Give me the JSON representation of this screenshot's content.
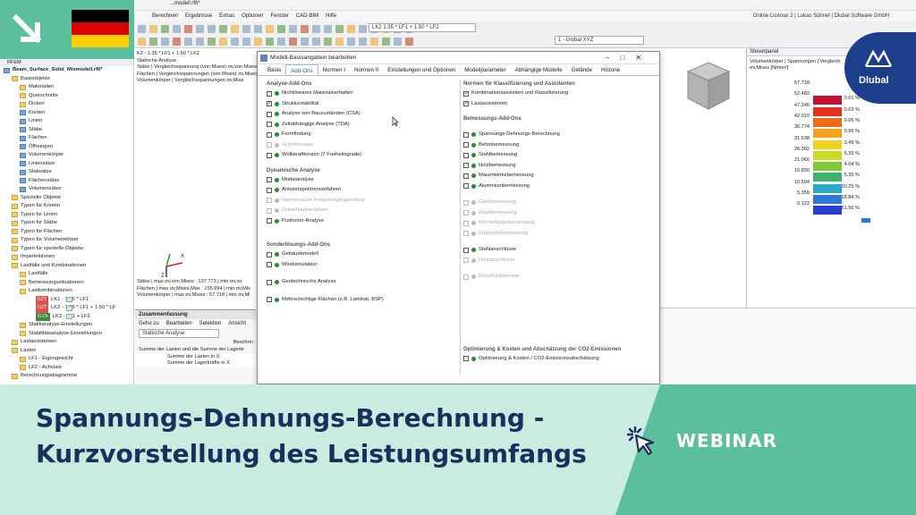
{
  "window": {
    "title_fragment": "...modell.rf6*",
    "license": "Online License 2 | Lukas Sühnel | Dlubal Software GmbH"
  },
  "menubar": [
    "Berechnen",
    "Ergebnisse",
    "Extras",
    "Optionen",
    "Fenster",
    "CAD-BIM",
    "Hilfe"
  ],
  "toolbar": {
    "load_combo": "LK2   1.35 * LF1 + 1.50 * LF2",
    "view_combo": "1 - Global XYZ"
  },
  "tree": {
    "header": "RFEM",
    "items": [
      {
        "label": "Beam_Surface_Solid_Mixmodell.rf6*",
        "indent": 0,
        "icon": "b",
        "bold": true
      },
      {
        "label": "Basisobjekte",
        "indent": 1,
        "icon": "f"
      },
      {
        "label": "Materialien",
        "indent": 2,
        "icon": "f"
      },
      {
        "label": "Querschnitte",
        "indent": 2,
        "icon": "f"
      },
      {
        "label": "Dicken",
        "indent": 2,
        "icon": "f"
      },
      {
        "label": "Knoten",
        "indent": 2,
        "icon": "b"
      },
      {
        "label": "Linien",
        "indent": 2,
        "icon": "b"
      },
      {
        "label": "Stäbe",
        "indent": 2,
        "icon": "b"
      },
      {
        "label": "Flächen",
        "indent": 2,
        "icon": "b"
      },
      {
        "label": "Öffnungen",
        "indent": 2,
        "icon": "b"
      },
      {
        "label": "Volumenkörper",
        "indent": 2,
        "icon": "b"
      },
      {
        "label": "Liniensätze",
        "indent": 2,
        "icon": "b"
      },
      {
        "label": "Stabsätze",
        "indent": 2,
        "icon": "b"
      },
      {
        "label": "Flächensätze",
        "indent": 2,
        "icon": "b"
      },
      {
        "label": "Volumensätze",
        "indent": 2,
        "icon": "b"
      },
      {
        "label": "Spezielle Objekte",
        "indent": 1,
        "icon": "f"
      },
      {
        "label": "Typen für Knoten",
        "indent": 1,
        "icon": "f"
      },
      {
        "label": "Typen für Linien",
        "indent": 1,
        "icon": "f"
      },
      {
        "label": "Typen für Stäbe",
        "indent": 1,
        "icon": "f"
      },
      {
        "label": "Typen für Flächen",
        "indent": 1,
        "icon": "f"
      },
      {
        "label": "Typen für Volumenkörper",
        "indent": 1,
        "icon": "f"
      },
      {
        "label": "Typen für spezielle Objekte",
        "indent": 1,
        "icon": "f"
      },
      {
        "label": "Imperfektionen",
        "indent": 1,
        "icon": "f"
      },
      {
        "label": "Lastfälle und Kombinationen",
        "indent": 1,
        "icon": "f"
      },
      {
        "label": "Lastfälle",
        "indent": 2,
        "icon": "f"
      },
      {
        "label": "Bemessungssituationen",
        "indent": 2,
        "icon": "f"
      },
      {
        "label": "Lastkombinationen",
        "indent": 2,
        "icon": "f"
      },
      {
        "label": "LK1 - 1.35 * LF1",
        "indent": 4,
        "icon": "lc",
        "tag": "GZT"
      },
      {
        "label": "LK2 - 1.35 * LF1 + 1.50 * LF",
        "indent": 4,
        "icon": "lc",
        "tag": "GZT"
      },
      {
        "label": "LK3 - LF1 + LF2",
        "indent": 4,
        "icon": "lc",
        "tag": "G.Ch"
      },
      {
        "label": "Statikanalyse-Einstellungen",
        "indent": 2,
        "icon": "f"
      },
      {
        "label": "Stabilitätsanalyse-Einstellungen",
        "indent": 2,
        "icon": "f"
      },
      {
        "label": "Lastassistenten",
        "indent": 1,
        "icon": "f"
      },
      {
        "label": "Lasten",
        "indent": 1,
        "icon": "f"
      },
      {
        "label": "LF1 - Eigengewicht",
        "indent": 2,
        "icon": "f"
      },
      {
        "label": "LF2 - Achslast",
        "indent": 2,
        "icon": "f"
      },
      {
        "label": "Berechnungsdiagramme",
        "indent": 1,
        "icon": "f"
      }
    ]
  },
  "work": {
    "lines_top": [
      "K2 - 1.35 * LF1 + 1.50 * LF2",
      "Statische Analyse",
      "Stäbe | Vergleichsspannung (von Mises) σv,von Mises [N/",
      "Flächen | Vergleichsspannungen (von Mises) σv,Mises",
      "Volumenkörper | Vergleichsspannungen σv,Mise"
    ],
    "lines_bottom": [
      "Stäbe | max σv,von Mises : 137.773 | min σv,vo",
      "Flächen | max σv,Mises,Max : 155.994 | min σv,Mis",
      "Volumenkörper | max σv,Mises : 57.718 | min σv,Mi"
    ],
    "axis_x": "X",
    "axis_z": "Z"
  },
  "summary": {
    "title": "Zusammenfassung",
    "menu": [
      "Gehe zu",
      "Bearbeiten",
      "Selektion",
      "Ansicht"
    ],
    "combo": "Statische Analyse",
    "col": "Beschrei",
    "rows": [
      "Summe der Lasten und die Summe der Lagerkr",
      "Summe der Lasten in X",
      "Summe der Lagerkräfte in X"
    ]
  },
  "dialog": {
    "title": "Modell-Basisangaben bearbeiten",
    "tabs": [
      "Basis",
      "Add-Ons",
      "Normen I",
      "Normen II",
      "Einstellungen und Optionen",
      "Modellparameter",
      "Abhängige Modelle",
      "Gelände",
      "Historie"
    ],
    "active_tab": "Add-Ons",
    "left_sections": [
      {
        "title": "Analyse-Add-Ons",
        "items": [
          {
            "label": "Nichtlineares Materialverhalten",
            "checked": false,
            "dot": true,
            "disabled": false
          },
          {
            "label": "Strukturstabilität",
            "checked": true,
            "dot": true,
            "disabled": false
          },
          {
            "label": "Analyse von Bauzuständen (CSA)",
            "checked": false,
            "dot": true,
            "disabled": false
          },
          {
            "label": "Zeitabhängige Analyse (TDA)",
            "checked": false,
            "dot": true,
            "disabled": false
          },
          {
            "label": "Formfindung",
            "checked": false,
            "dot": true,
            "disabled": false
          },
          {
            "label": "Schnittmuster",
            "checked": false,
            "dot": true,
            "disabled": true
          },
          {
            "label": "Wölbkrafttorsion (7 Freiheitsgrade)",
            "checked": false,
            "dot": true,
            "disabled": false
          }
        ]
      },
      {
        "title": "Dynamische Analyse",
        "items": [
          {
            "label": "Modalanalyse",
            "checked": false,
            "dot": true,
            "disabled": false
          },
          {
            "label": "Antwortspektrenverfahren",
            "checked": false,
            "dot": true,
            "disabled": false
          },
          {
            "label": "Harmonische Frequenzganganalyse",
            "checked": false,
            "dot": true,
            "disabled": true
          },
          {
            "label": "Zeitverlaufverfahren",
            "checked": false,
            "dot": true,
            "disabled": true
          },
          {
            "label": "Pushover-Analyse",
            "checked": false,
            "dot": true,
            "disabled": false
          }
        ]
      },
      {
        "title": "Sonderlösungs-Add-Ons",
        "items": [
          {
            "label": "Gebäudemodell",
            "checked": false,
            "dot": true,
            "disabled": false
          },
          {
            "label": "Windsimulation",
            "checked": false,
            "dot": true,
            "disabled": false
          },
          {
            "label": "Geotechnische Analyse",
            "checked": false,
            "dot": true,
            "disabled": false
          },
          {
            "label": "Mehrschichtige Flächen (z.B. Laminat, BSP)",
            "checked": false,
            "dot": true,
            "disabled": false
          }
        ]
      }
    ],
    "right_sections": [
      {
        "title": "Normen für Klassifizierung und Assistenten",
        "items": [
          {
            "label": "Kombinationsassistent und Klassifizierung",
            "checked": true,
            "dot": false,
            "disabled": false
          },
          {
            "label": "Lastassistenten",
            "checked": true,
            "dot": false,
            "disabled": false
          }
        ]
      },
      {
        "title": "Bemessungs-Add-Ons",
        "items": [
          {
            "label": "Spannungs-Dehnungs-Berechnung",
            "checked": false,
            "dot": true,
            "disabled": false
          },
          {
            "label": "Betonbemessung",
            "checked": false,
            "dot": true,
            "disabled": false
          },
          {
            "label": "Stahlbemessung",
            "checked": false,
            "dot": true,
            "disabled": false
          },
          {
            "label": "Holzbemessung",
            "checked": false,
            "dot": true,
            "disabled": false
          },
          {
            "label": "Mauerwerksbemessung",
            "checked": false,
            "dot": true,
            "disabled": false
          },
          {
            "label": "Aluminiumbemessung",
            "checked": false,
            "dot": true,
            "disabled": false
          },
          {
            "label": "Glasbemessung",
            "checked": false,
            "dot": true,
            "disabled": true
          },
          {
            "label": "Mastbemessung",
            "checked": false,
            "dot": true,
            "disabled": true
          },
          {
            "label": "Rohrleitungsbemessung",
            "checked": false,
            "dot": true,
            "disabled": true
          },
          {
            "label": "Kranbahnbemessung",
            "checked": false,
            "dot": true,
            "disabled": true
          },
          {
            "label": "Stahlanschlüsse",
            "checked": false,
            "dot": true,
            "disabled": false
          },
          {
            "label": "Holzanschlüsse",
            "checked": false,
            "dot": true,
            "disabled": true
          },
          {
            "label": "Betonfundamente",
            "checked": false,
            "dot": true,
            "disabled": true
          }
        ]
      },
      {
        "title": "Optimierung & Kosten und Abschätzung der CO2-Emissionen",
        "items": [
          {
            "label": "Optimierung & Kosten / CO2-Emissionsabschätzung",
            "checked": false,
            "dot": true,
            "disabled": false
          }
        ]
      }
    ]
  },
  "steuerpanel": {
    "title": "Steuerpanel",
    "subtitle": "Volumenkörper | Spannungen | Vergleich",
    "unit": "σv,Mises [N/mm²]",
    "legend": [
      {
        "value": "57.718",
        "color": "",
        "pct": ""
      },
      {
        "value": "52.482",
        "color": "#c8102e",
        "pct": "0.01 %"
      },
      {
        "value": "47.246",
        "color": "#e4301c",
        "pct": "0.03 %"
      },
      {
        "value": "42.010",
        "color": "#f06a1c",
        "pct": "0.05 %"
      },
      {
        "value": "36.774",
        "color": "#f6a21c",
        "pct": "0.99 %"
      },
      {
        "value": "31.538",
        "color": "#f2d21a",
        "pct": "3.49 %"
      },
      {
        "value": "26.302",
        "color": "#c8dc24",
        "pct": "5.39 %"
      },
      {
        "value": "21.066",
        "color": "#7ec83a",
        "pct": "4.04 %"
      },
      {
        "value": "15.830",
        "color": "#3cb46e",
        "pct": "5.35 %"
      },
      {
        "value": "10.594",
        "color": "#2aa8c8",
        "pct": "10.25 %"
      },
      {
        "value": "5.358",
        "color": "#2a78d8",
        "pct": "18.84 %"
      },
      {
        "value": "0.122",
        "color": "#2a3ed0",
        "pct": "51.56 %"
      }
    ]
  },
  "banner": {
    "headline_line1": "Spannungs-Dehnungs-Berechnung -",
    "headline_line2": "Kurzvorstellung des Leistungsumfangs",
    "label": "WEBINAR"
  },
  "logo": {
    "text": "Dlubal",
    "colors": {
      "bg": "#1d3e8a"
    }
  },
  "colors": {
    "teal": "#5bbf9e",
    "mint": "#c8ece0",
    "navy": "#1c2e5c",
    "check_green": "#1f8f2f"
  },
  "icons": [
    "arrow-down-right-icon",
    "flag-germany-icon",
    "cursor-click-icon",
    "dlubal-logo-icon",
    "coordinate-axes-icon",
    "view-cube-icon"
  ]
}
